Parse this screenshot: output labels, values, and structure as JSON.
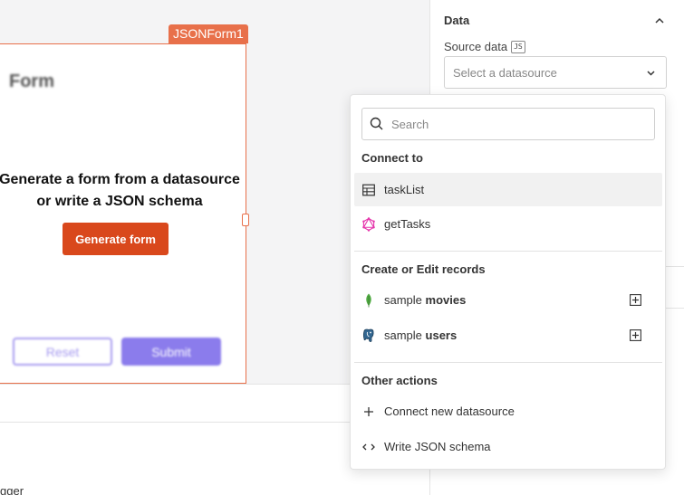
{
  "canvas": {
    "widget_name": "JSONForm1",
    "form_title": "Form",
    "generate_line1": "Generate a form from a datasource",
    "generate_line2": "or write a JSON schema",
    "generate_button": "Generate form",
    "reset_button": "Reset",
    "submit_button": "Submit",
    "bottom_text": "gger"
  },
  "property_pane": {
    "section_title": "Data",
    "source_label": "Source data",
    "js_badge": "JS",
    "select_placeholder": "Select a datasource"
  },
  "dropdown": {
    "search_placeholder": "Search",
    "connect_to": {
      "heading": "Connect to",
      "items": [
        {
          "label": "taskList",
          "icon": "table-icon"
        },
        {
          "label": "getTasks",
          "icon": "graphql-icon"
        }
      ]
    },
    "create_edit": {
      "heading": "Create or Edit records",
      "items": [
        {
          "prefix": "sample ",
          "name": "movies",
          "icon": "mongodb-leaf-icon"
        },
        {
          "prefix": "sample ",
          "name": "users",
          "icon": "postgres-elephant-icon"
        }
      ]
    },
    "other_actions": {
      "heading": "Other actions",
      "items": [
        {
          "label": "Connect new datasource",
          "icon": "plus-icon"
        },
        {
          "label": "Write JSON schema",
          "icon": "code-icon"
        }
      ]
    }
  },
  "colors": {
    "widget_accent": "#e8704a",
    "generate_button": "#d9481c",
    "submit_button": "#8b7cec",
    "mongodb_green": "#4faa41",
    "graphql_pink": "#e535ab"
  }
}
